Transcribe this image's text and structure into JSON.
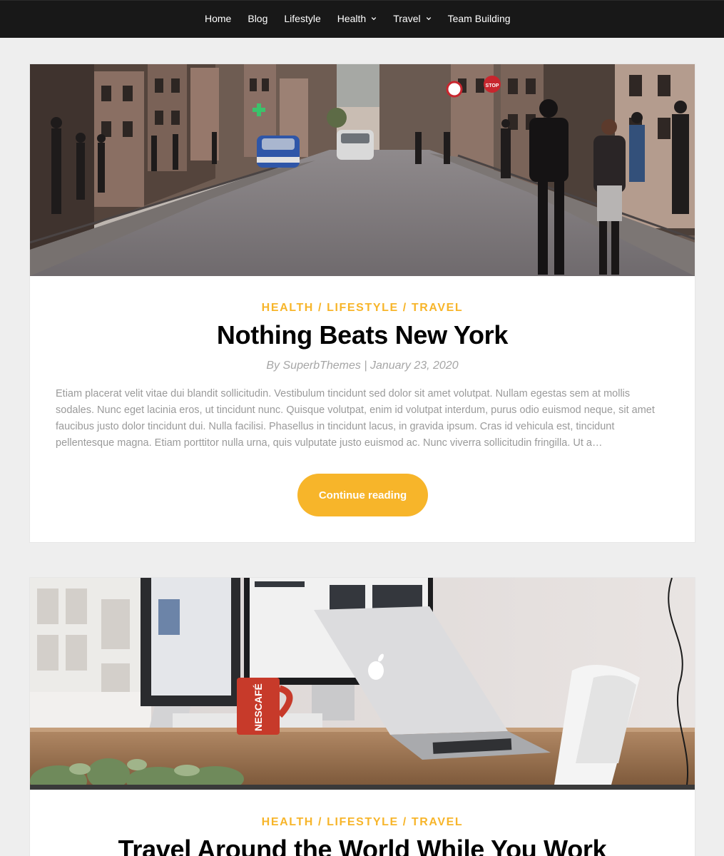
{
  "nav": {
    "items": [
      {
        "label": "Home",
        "has_dropdown": false
      },
      {
        "label": "Blog",
        "has_dropdown": false
      },
      {
        "label": "Lifestyle",
        "has_dropdown": false
      },
      {
        "label": "Health",
        "has_dropdown": true
      },
      {
        "label": "Travel",
        "has_dropdown": true
      },
      {
        "label": "Team Building",
        "has_dropdown": false
      }
    ]
  },
  "colors": {
    "nav_bg": "#181818",
    "accent": "#f7b52a",
    "page_bg": "#eeeeee",
    "card_bg": "#ffffff",
    "muted_text": "#9a9a9a"
  },
  "posts": [
    {
      "image": "city-street-photo",
      "categories": [
        "HEALTH",
        "LIFESTYLE",
        "TRAVEL"
      ],
      "category_separator": " / ",
      "title": "Nothing Beats New York",
      "author_prefix": "By",
      "author": "SuperbThemes",
      "meta_separator": "|",
      "date": "January 23, 2020",
      "excerpt": "Etiam placerat velit vitae dui blandit sollicitudin. Vestibulum tincidunt sed dolor sit amet volutpat. Nullam egestas sem at mollis sodales. Nunc eget lacinia eros, ut tincidunt nunc. Quisque volutpat, enim id volutpat interdum, purus odio euismod neque, sit amet faucibus justo dolor tincidunt dui. Nulla facilisi. Phasellus in tincidunt lacus, in gravida ipsum. Cras id vehicula est, tincidunt pellentesque magna. Etiam porttitor nulla urna, quis vulputate justo euismod ac. Nunc viverra sollicitudin fringilla. Ut a…",
      "button": "Continue reading"
    },
    {
      "image": "desk-workspace-photo",
      "categories": [
        "HEALTH",
        "LIFESTYLE",
        "TRAVEL"
      ],
      "category_separator": " / ",
      "title": "Travel Around the World While You Work"
    }
  ],
  "images": {
    "street_signs": [
      "STOP"
    ],
    "mug_text": "NESCAFÉ"
  }
}
